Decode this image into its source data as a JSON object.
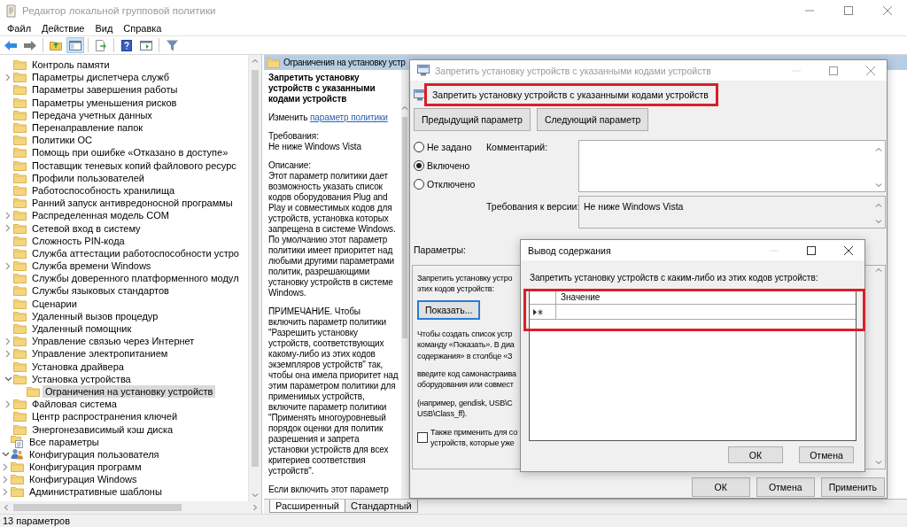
{
  "window": {
    "title": "Редактор локальной групповой политики"
  },
  "menu": [
    "Файл",
    "Действие",
    "Вид",
    "Справка"
  ],
  "tree": [
    {
      "children": [
        {
          "children": [
            {
              "children": [
                {
                  "label": "Контроль памяти",
                  "selected": false
                },
                {
                  "label": "Параметры диспетчера служб",
                  "selected": false,
                  "expanded": false
                },
                {
                  "label": "Параметры завершения работы",
                  "selected": false
                },
                {
                  "label": "Параметры уменьшения рисков",
                  "selected": false
                },
                {
                  "label": "Передача учетных данных",
                  "selected": false
                },
                {
                  "label": "Перенаправление папок",
                  "selected": false
                },
                {
                  "label": "Политики ОС",
                  "selected": false
                },
                {
                  "label": "Помощь при ошибке «Отказано в доступе»",
                  "selected": false
                },
                {
                  "label": "Поставщик теневых копий файлового ресурс",
                  "selected": false
                },
                {
                  "label": "Профили пользователей",
                  "selected": false
                },
                {
                  "label": "Работоспособность хранилища",
                  "selected": false
                },
                {
                  "label": "Ранний запуск антивредоносной программы",
                  "selected": false
                },
                {
                  "label": "Распределенная модель COM",
                  "selected": false,
                  "expanded": false
                },
                {
                  "label": "Сетевой вход в систему",
                  "selected": false,
                  "expanded": false
                },
                {
                  "label": "Сложность PIN-кода",
                  "selected": false
                },
                {
                  "label": "Служба аттестации работоспособности устро",
                  "selected": false
                },
                {
                  "label": "Служба времени Windows",
                  "selected": false,
                  "expanded": false
                },
                {
                  "label": "Службы доверенного платформенного модул",
                  "selected": false
                },
                {
                  "label": "Службы языковых стандартов",
                  "selected": false
                },
                {
                  "label": "Сценарии",
                  "selected": false
                },
                {
                  "label": "Удаленный вызов процедур",
                  "selected": false
                },
                {
                  "label": "Удаленный помощник",
                  "selected": false
                },
                {
                  "label": "Управление связью через Интернет",
                  "selected": false,
                  "expanded": false
                },
                {
                  "label": "Управление электропитанием",
                  "selected": false,
                  "expanded": false
                },
                {
                  "label": "Установка драйвера",
                  "selected": false
                },
                {
                  "label": "Установка устройства",
                  "selected": false,
                  "expanded": true,
                  "children": [
                    {
                      "label": "Ограничения на установку устройств",
                      "selected": true
                    }
                  ]
                },
                {
                  "label": "Файловая система",
                  "selected": false,
                  "expanded": false
                },
                {
                  "label": "Центр распространения ключей",
                  "selected": false
                },
                {
                  "label": "Энергонезависимый кэш диска",
                  "selected": false
                }
              ]
            },
            {
              "label": "Все параметры",
              "kind": "all",
              "selected": false
            }
          ]
        }
      ]
    },
    {
      "label": "Конфигурация пользователя",
      "kind": "user",
      "selected": false,
      "expanded": true,
      "children": [
        {
          "label": "Конфигурация программ",
          "selected": false,
          "expanded": false
        },
        {
          "label": "Конфигурация Windows",
          "selected": false,
          "expanded": false
        },
        {
          "label": "Административные шаблоны",
          "selected": false,
          "expanded": false
        }
      ]
    }
  ],
  "details": {
    "header": "Ограничения на установку устр",
    "title": "Запретить установку устройств с указанными кодами устройств",
    "edit_prefix": "Изменить",
    "edit_link": "параметр политики",
    "requirements_label": "Требования:",
    "requirements": "Не ниже Windows Vista",
    "description_label": "Описание:",
    "paragraphs": [
      "Этот параметр политики дает возможность указать список кодов оборудования Plug and Play и совместимых кодов для устройств, установка которых запрещена в системе Windows. По умолчанию этот параметр политики имеет приоритет над любыми другими параметрами политик, разрешающими установку устройств в системе Windows.",
      "ПРИМЕЧАНИЕ. Чтобы включить параметр политики \"Разрешить установку устройств, соответствующих какому-либо из этих кодов экземпляров устройств\" так, чтобы она имела приоритет над этим параметром политики для применимых устройств, включите параметр политики \"Применять многоуровневый порядок оценки для политик разрешения и запрета установки устройств для всех критериев соответствия устройств\".",
      "Если включить этот параметр"
    ]
  },
  "view_tabs": [
    {
      "label": "Расширенный",
      "selected": true
    },
    {
      "label": "Стандартный",
      "selected": false
    }
  ],
  "status_bar": "13 параметров",
  "policy_dialog": {
    "title": "Запретить установку устройств с указанными кодами устройств",
    "heading": "Запретить установку устройств с указанными кодами устройств",
    "nav_buttons": [
      "Предыдущий параметр",
      "Следующий параметр"
    ],
    "states": [
      {
        "label": "Не задано",
        "selected": false
      },
      {
        "label": "Включено",
        "selected": true
      },
      {
        "label": "Отключено",
        "selected": false
      }
    ],
    "comment_label": "Комментарий:",
    "version_label": "Требования к версии:",
    "version_value": "Не ниже Windows Vista",
    "params_label": "Параметры:",
    "options": {
      "intro": [
        "Запретить установку устро",
        "этих кодов устройств:"
      ],
      "show_button": "Показать...",
      "help": [
        [
          "Чтобы создать список устр",
          "команду «Показать». В диа",
          "содержания» в столбце «З"
        ],
        [
          "введите код самонастраива",
          "оборудования или совмест"
        ],
        [
          "(например, gendisk, USB\\C",
          "USB\\Class_ff)."
        ]
      ],
      "checkbox": {
        "lines": [
          "Также применить для со",
          "устройств, которые уже"
        ],
        "checked": false
      }
    },
    "buttons": [
      "ОК",
      "Отмена",
      "Применить"
    ]
  },
  "content_dialog": {
    "title": "Вывод содержания",
    "label": "Запретить установку устройств с каким-либо из этих кодов устройств:",
    "column": "Значение",
    "buttons": [
      "ОК",
      "Отмена"
    ]
  }
}
